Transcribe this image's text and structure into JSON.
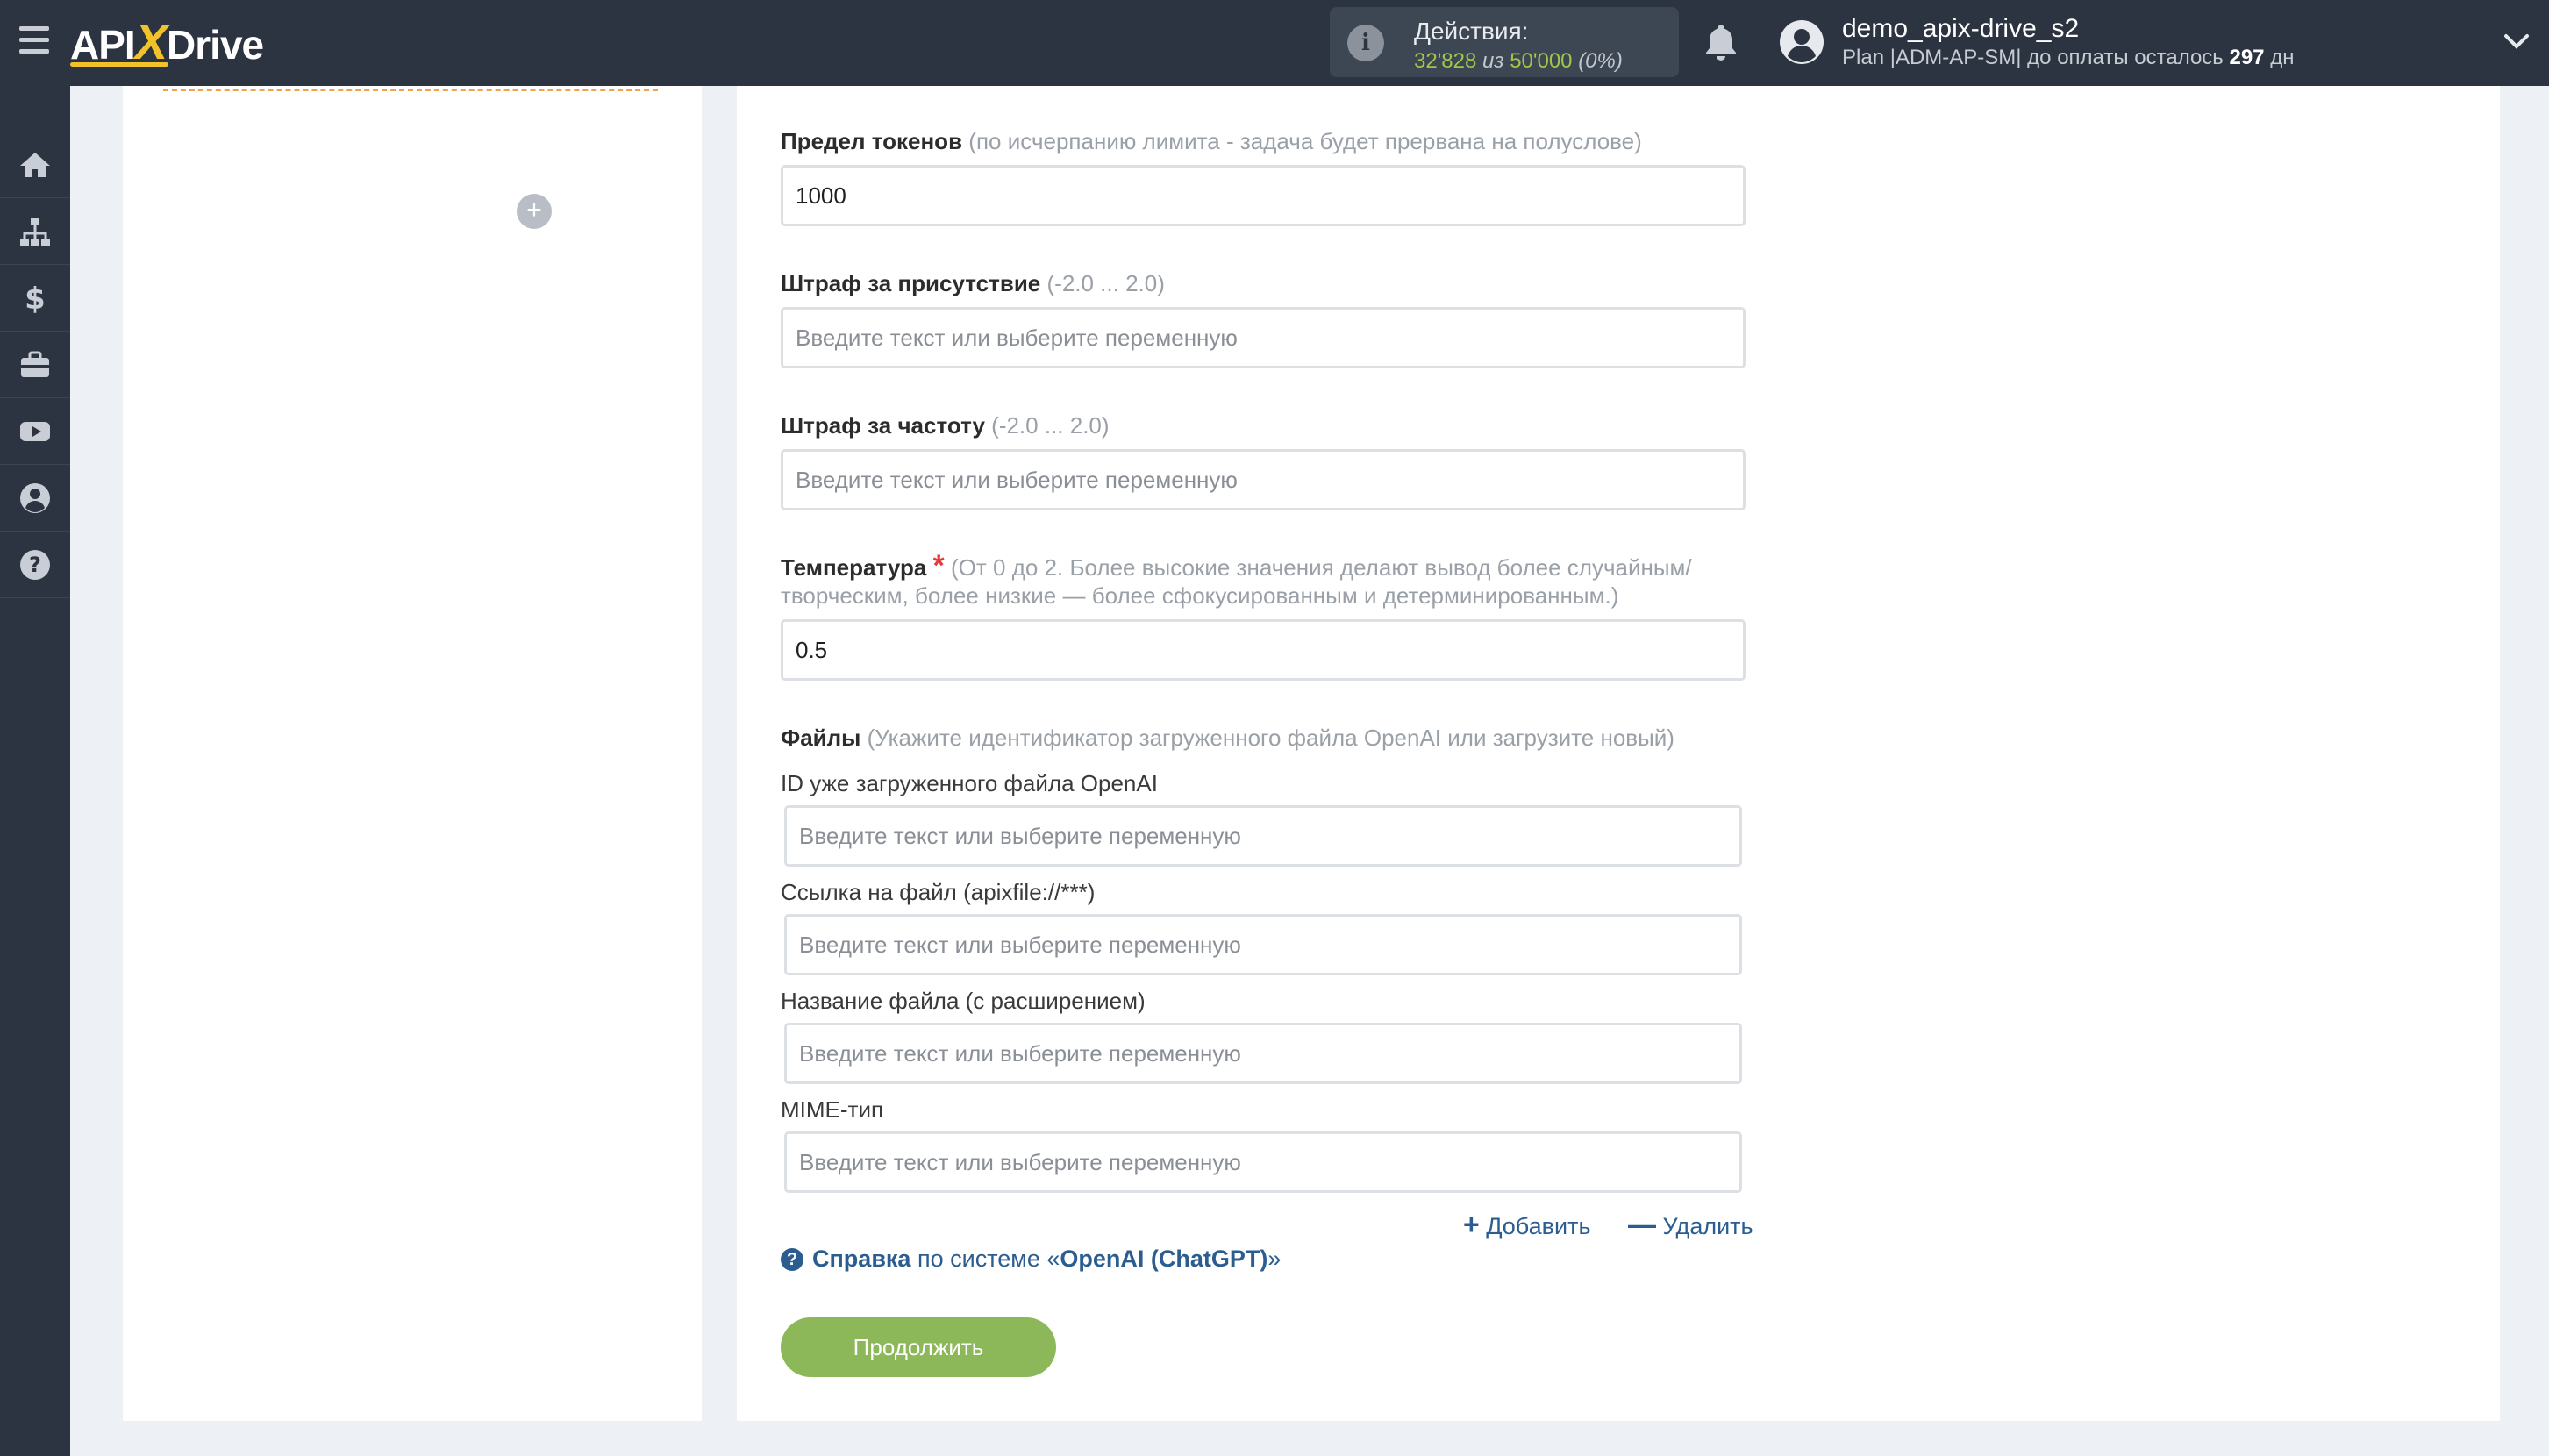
{
  "brand": {
    "logo_prefix": "API",
    "logo_x": "X",
    "logo_suffix": "Drive"
  },
  "header": {
    "actions_label": "Действия:",
    "actions_used": "32'828",
    "actions_of": "из",
    "actions_total": "50'000",
    "actions_percent": "(0%)",
    "user_name": "demo_apix-drive_s2",
    "plan_text": "Plan |ADM-AP-SM| до оплаты осталось",
    "plan_days": "297",
    "plan_days_unit": "дн"
  },
  "sidebar": {
    "items": [
      {
        "icon": "home-icon"
      },
      {
        "icon": "sitemap-icon"
      },
      {
        "icon": "dollar-icon"
      },
      {
        "icon": "briefcase-icon"
      },
      {
        "icon": "youtube-icon"
      },
      {
        "icon": "user-circle-icon"
      },
      {
        "icon": "help-icon"
      }
    ]
  },
  "form": {
    "tokens": {
      "label": "Предел токенов",
      "hint": "(по исчерпанию лимита - задача будет прервана на полуслове)",
      "value": "1000"
    },
    "presence_penalty": {
      "label": "Штраф за присутствие",
      "hint": "(-2.0 ... 2.0)",
      "placeholder": "Введите текст или выберите переменную"
    },
    "frequency_penalty": {
      "label": "Штраф за частоту",
      "hint": "(-2.0 ... 2.0)",
      "placeholder": "Введите текст или выберите переменную"
    },
    "temperature": {
      "label": "Температура",
      "required_mark": "*",
      "hint_line1": "(От 0 до 2. Более высокие значения делают вывод более случайным/",
      "hint_line2": "творческим, более низкие — более сфокусированным и детерминированным.)",
      "value": "0.5"
    },
    "files": {
      "label": "Файлы",
      "hint": "(Укажите идентификатор загруженного файла OpenAI или загрузите новый)",
      "file_id_label": "ID уже загруженного файла OpenAI",
      "file_link_label": "Ссылка на файл (apixfile://***)",
      "file_name_label": "Название файла (с расширением)",
      "mime_label": "MIME-тип",
      "placeholder": "Введите текст или выберите переменную"
    },
    "add_label": "Добавить",
    "add_symbol": "+",
    "remove_label": "Удалить",
    "remove_symbol": "—",
    "help_prefix": "Справка",
    "help_middle": "по системе «",
    "help_system": "OpenAI (ChatGPT)",
    "help_suffix": "»",
    "continue_label": "Продолжить"
  },
  "colors": {
    "topbar": "#2c3441",
    "accent_green": "#8db85a",
    "link_blue": "#2b5d91",
    "logo_yellow": "#f2c22a"
  }
}
